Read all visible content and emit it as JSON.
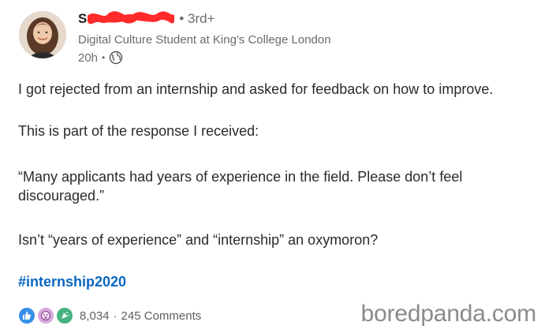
{
  "author": {
    "name_initial": "S",
    "degree": "• 3rd+",
    "headline": "Digital Culture Student at King's College London",
    "time": "20h",
    "visibility_icon": "globe-icon"
  },
  "post": {
    "paragraph_1": "I got rejected from an internship and asked for feedback on how to improve.",
    "paragraph_2": "This is part of the response I received:",
    "paragraph_3": "“Many applicants had years of experience in the field. Please don’t feel discouraged.”",
    "paragraph_4": "Isn’t “years of experience” and “internship” an oxymoron?",
    "hashtag": "#internship2020"
  },
  "social": {
    "reactions": [
      "like-icon",
      "curious-icon",
      "celebrate-icon"
    ],
    "reaction_count": "8,034",
    "separator": "·",
    "comments": "245 Comments"
  },
  "watermark": "boredpanda.com",
  "colors": {
    "link": "#0a66c2",
    "redaction": "#ff2a2a",
    "meta_text": "#6b6b6b"
  }
}
